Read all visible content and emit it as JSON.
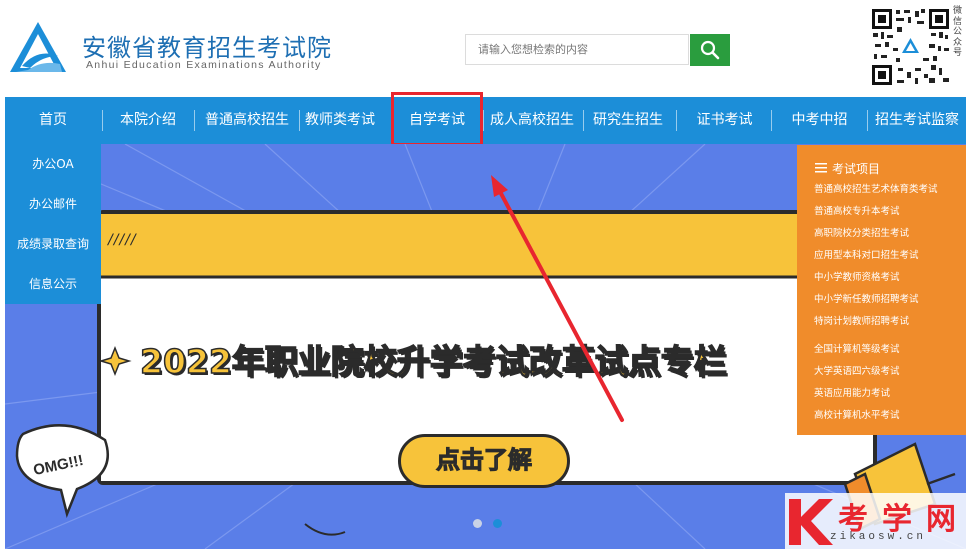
{
  "header": {
    "title": "安徽省教育招生考试院",
    "subtitle": "Anhui Education Examinations Authority",
    "search_placeholder": "请输入您想检索的内容",
    "qr_label": "微信公众号"
  },
  "nav": {
    "items": [
      {
        "label": "首页"
      },
      {
        "label": "本院介绍"
      },
      {
        "label": "普通高校招生"
      },
      {
        "label": "教师类考试"
      },
      {
        "label": "自学考试"
      },
      {
        "label": "成人高校招生"
      },
      {
        "label": "研究生招生"
      },
      {
        "label": "证书考试"
      },
      {
        "label": "中考中招"
      },
      {
        "label": "招生考试监察"
      }
    ]
  },
  "sidebar_left": {
    "items": [
      {
        "label": "办公OA"
      },
      {
        "label": "办公邮件"
      },
      {
        "label": "成绩录取查询"
      },
      {
        "label": "信息公示"
      }
    ]
  },
  "sidebar_right": {
    "title": "考试项目",
    "items": [
      {
        "label": "普通高校招生艺术体育类考试"
      },
      {
        "label": "普通高校专升本考试"
      },
      {
        "label": "高职院校分类招生考试"
      },
      {
        "label": "应用型本科对口招生考试"
      },
      {
        "label": "中小学教师资格考试"
      },
      {
        "label": "中小学新任教师招聘考试"
      },
      {
        "label": "特岗计划教师招聘考试"
      },
      {
        "label": "全国计算机等级考试"
      },
      {
        "label": "大学英语四六级考试"
      },
      {
        "label": "英语应用能力考试"
      },
      {
        "label": "高校计算机水平考试"
      }
    ]
  },
  "banner": {
    "title": "2022年职业院校升学考试改革试点专栏",
    "button": "点击了解",
    "bubble": "OMG!!!",
    "slashes": "/////"
  },
  "watermark": {
    "text": "考学网",
    "url": "zikaosw.cn"
  },
  "colors": {
    "nav_blue": "#1c8ed8",
    "orange": "#f08c2b",
    "search_green": "#2a9d3e",
    "highlight_red": "#e8262f",
    "banner_yellow": "#f7c33a",
    "banner_blue": "#5a7ee8"
  }
}
